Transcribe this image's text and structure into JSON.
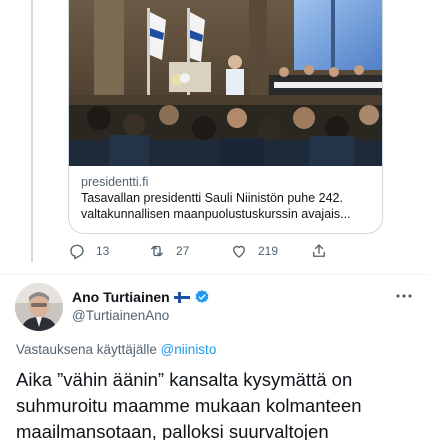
{
  "link_card": {
    "image_alt": "",
    "domain": "presidentti.fi",
    "title_line1": "Tasavallan presidentti Sauli Niinistön puhe 242.",
    "title_line2": "valtakunnallisen maanpuolustuskurssin avajais..."
  },
  "actions": {
    "reply_count": "13",
    "retweet_count": "27",
    "like_count": "219",
    "share_label": ""
  },
  "tweet": {
    "display_name": "Ano Turtiainen",
    "handle": "@TurtiainenAno",
    "verified_color": "#1d9bf0",
    "reply_prefix": "Vastauksena käyttäjälle ",
    "reply_mention": "@niinisto",
    "body_lines": [
      "Aika ”vähin äänin” kansalta kysymättä on",
      "suhmuroitu maamme mukaan kolmanteen",
      "maailmansotaan, palloksi suurvaltojen"
    ]
  },
  "colors": {
    "accent": "#1d9bf0",
    "secondary_text": "#536471",
    "border": "#cfd9de"
  }
}
